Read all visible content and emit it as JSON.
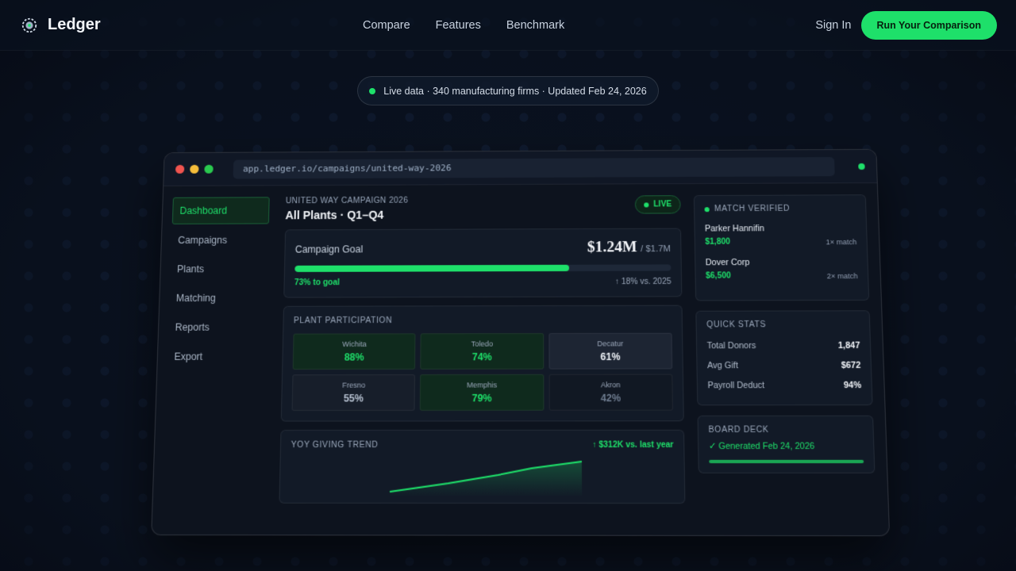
{
  "brand": {
    "name": "Ledger"
  },
  "nav": {
    "links": [
      "Compare",
      "Features",
      "Benchmark"
    ],
    "signin": "Sign In",
    "cta": "Run Your Comparison"
  },
  "banner": {
    "text": "Live data · 340 manufacturing firms · Updated Feb 24, 2026"
  },
  "window": {
    "url": "app.ledger.io/campaigns/united-way-2026",
    "sidebar": [
      "Dashboard",
      "Campaigns",
      "Plants",
      "Matching",
      "Reports",
      "Export"
    ],
    "header": {
      "eyebrow": "UNITED WAY CAMPAIGN 2026",
      "title": "All Plants · Q1–Q4",
      "badge": "LIVE"
    },
    "goal": {
      "label": "Campaign Goal",
      "amount": "$1.24M",
      "total": "/ $1.7M",
      "progress": 0.73,
      "pct_text": "73% to goal",
      "delta": "↑ 18% vs. 2025"
    },
    "plants": {
      "label": "PLANT PARTICIPATION",
      "items": [
        {
          "name": "Wichita",
          "value": "88%",
          "pct": 88
        },
        {
          "name": "Toledo",
          "value": "74%",
          "pct": 74
        },
        {
          "name": "Decatur",
          "value": "61%",
          "pct": 61
        },
        {
          "name": "Fresno",
          "value": "55%",
          "pct": 55
        },
        {
          "name": "Memphis",
          "value": "79%",
          "pct": 79
        },
        {
          "name": "Akron",
          "value": "42%",
          "pct": 42
        }
      ]
    },
    "trend": {
      "label": "YOY GIVING TREND",
      "delta": "↑ $312K vs. last year"
    },
    "match": {
      "label": "MATCH VERIFIED",
      "items": [
        {
          "name": "Parker Hannifin",
          "amount": "$1,800",
          "mult": "1× match"
        },
        {
          "name": "Dover Corp",
          "amount": "$6,500",
          "mult": "2× match"
        }
      ]
    },
    "stats": {
      "label": "QUICK STATS",
      "rows": [
        {
          "label": "Total Donors",
          "value": "1,847"
        },
        {
          "label": "Avg Gift",
          "value": "$672"
        },
        {
          "label": "Payroll Deduct",
          "value": "94%"
        }
      ]
    },
    "deck": {
      "label": "BOARD DECK",
      "status": "✓ Generated Feb 24, 2026"
    }
  },
  "colors": {
    "accent": "#1ee06a",
    "background": "#0a1220",
    "panel": "#121a27"
  }
}
